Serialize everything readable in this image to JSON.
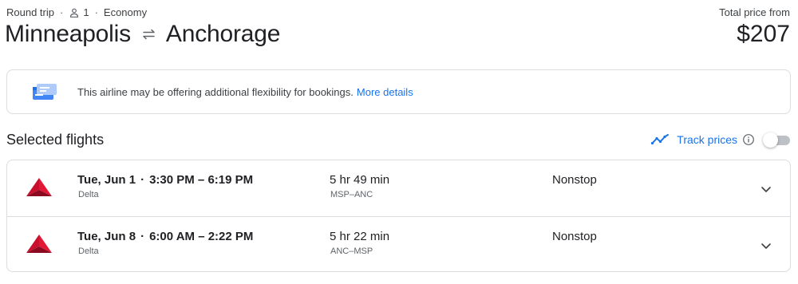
{
  "trip": {
    "type": "Round trip",
    "passengers": "1",
    "cabin": "Economy",
    "origin": "Minneapolis",
    "destination": "Anchorage"
  },
  "price": {
    "label": "Total price from",
    "amount": "$207"
  },
  "notice": {
    "text": "This airline may be offering additional flexibility for bookings.",
    "link": "More details"
  },
  "selected": {
    "title": "Selected flights",
    "track_label": "Track prices",
    "track_enabled": false
  },
  "flights": [
    {
      "date": "Tue, Jun 1",
      "times": "3:30 PM – 6:19 PM",
      "airline": "Delta",
      "duration": "5 hr 49 min",
      "airports": "MSP–ANC",
      "stops": "Nonstop"
    },
    {
      "date": "Tue, Jun 8",
      "times": "6:00 AM – 2:22 PM",
      "airline": "Delta",
      "duration": "5 hr 22 min",
      "airports": "ANC–MSP",
      "stops": "Nonstop"
    }
  ],
  "colors": {
    "accent": "#1a73e8",
    "delta_red": "#c8102e",
    "border": "#dadce0"
  }
}
